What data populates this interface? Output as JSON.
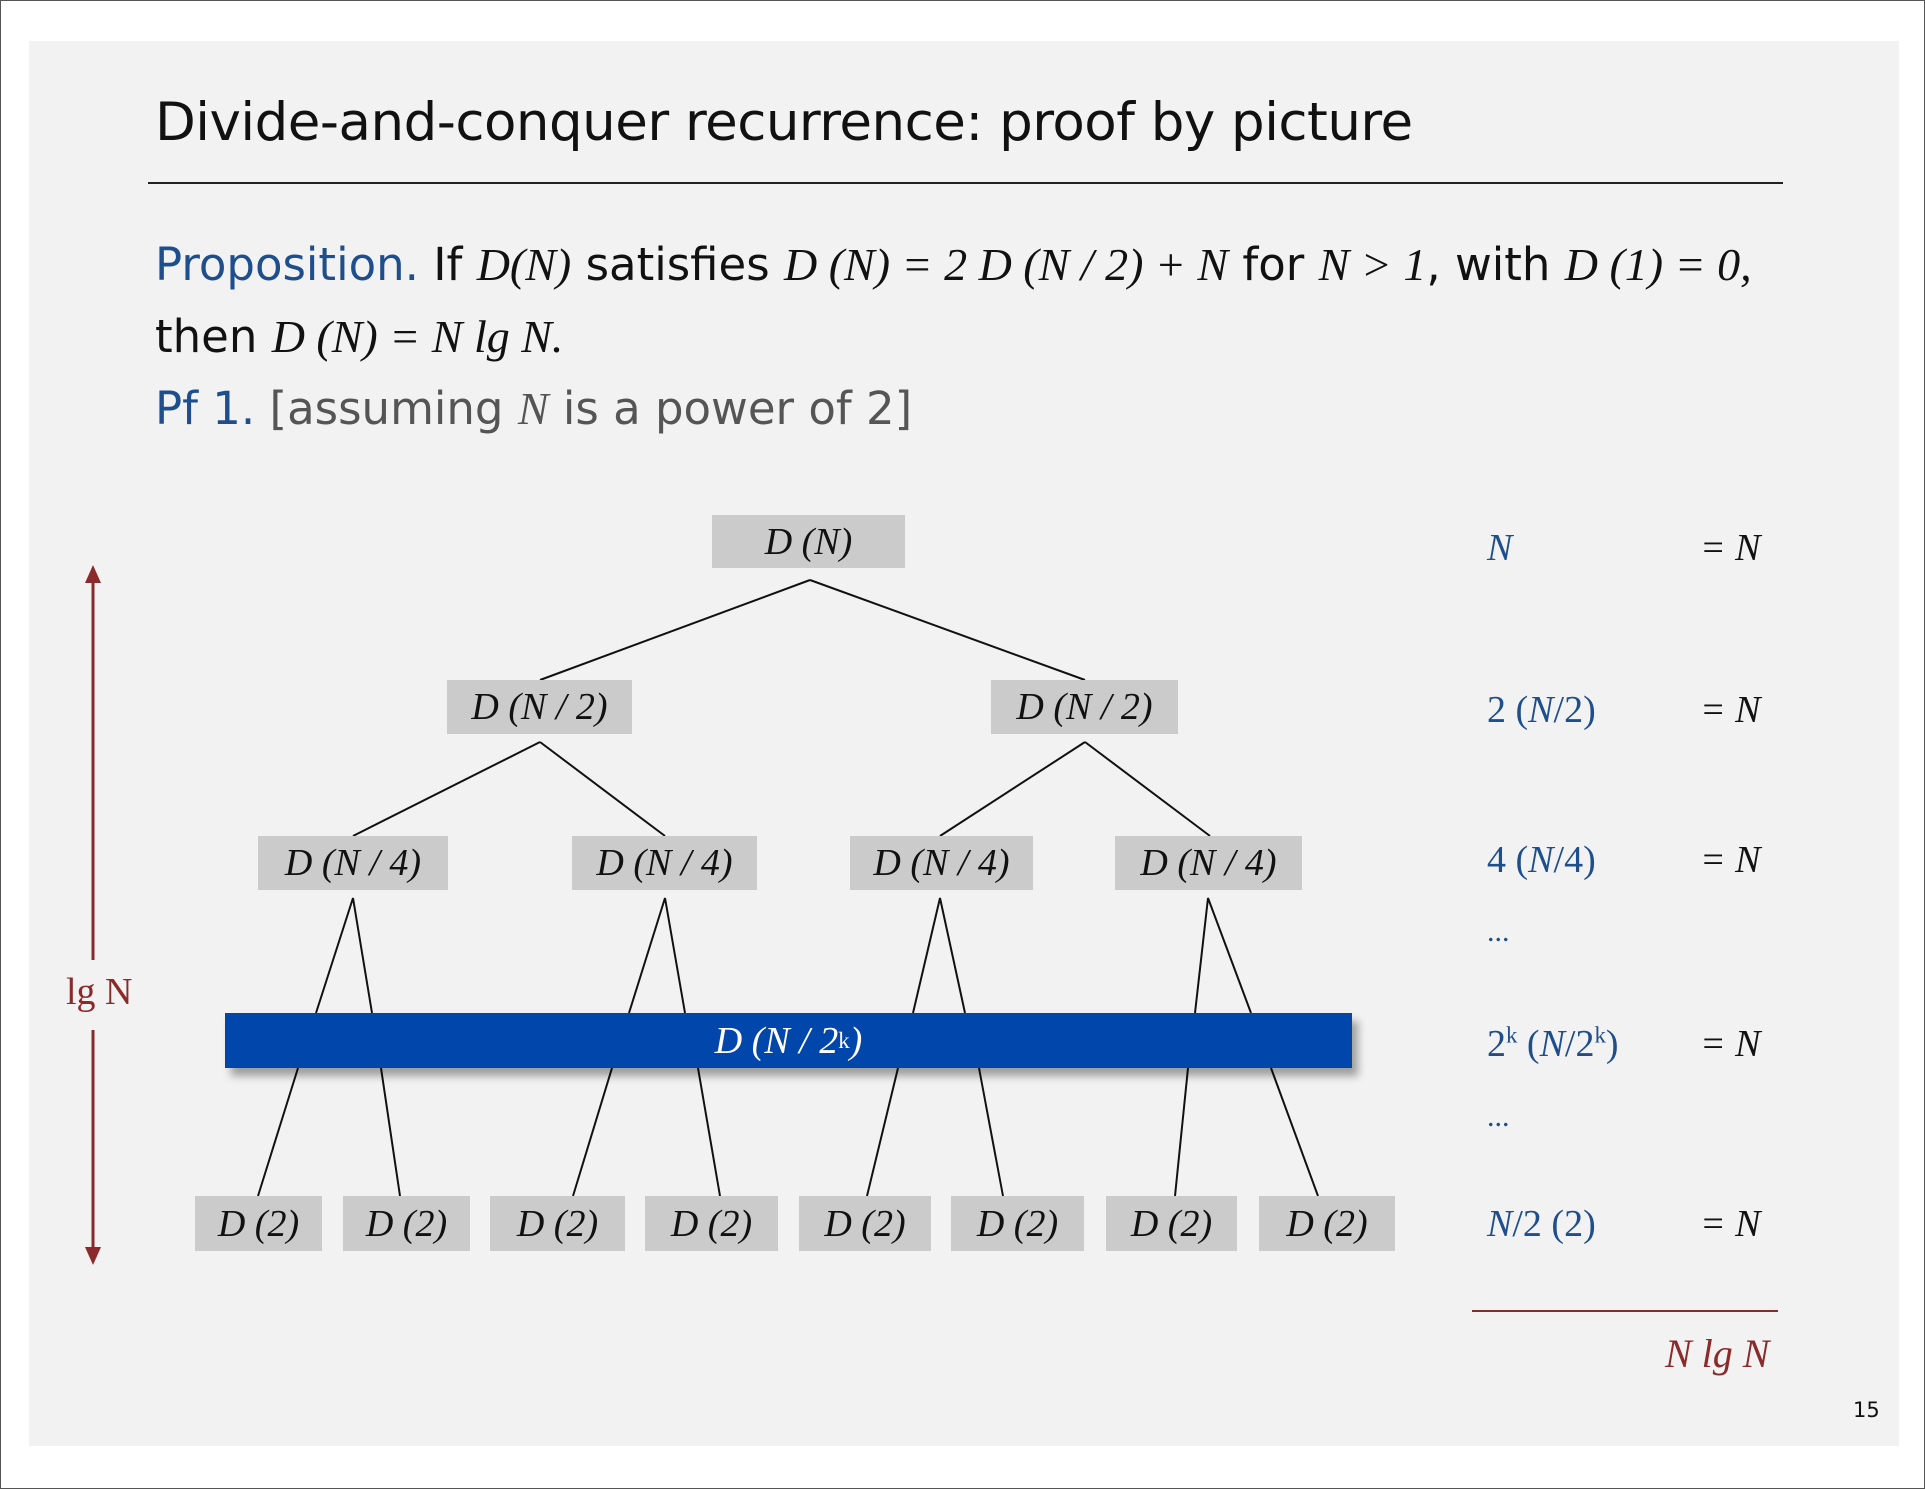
{
  "slide": {
    "title": "Divide-and-conquer recurrence:  proof by picture",
    "proposition_label": "Proposition.",
    "prop_if": "If",
    "prop_DN_a": "D",
    "prop_DN_b": "(N)",
    "prop_satisfies": "satisfies",
    "prop_eq_lhs": "D (N) = ",
    "prop_eq_rhs": "2 D (N / 2) + N",
    "prop_for": "for",
    "prop_cond": "N > 1",
    "prop_with": ", with",
    "prop_init": "D (1) = 0,",
    "then_label": "then",
    "then_expr": "D (N) = N lg N.",
    "pf_label": "Pf 1.",
    "pf_text_a": "[assuming",
    "pf_N": "N",
    "pf_text_b": "is a power of 2]",
    "page_number": "15"
  },
  "tree": {
    "root": "D (N)",
    "level1": [
      "D (N / 2)",
      "D (N / 2)"
    ],
    "level2": [
      "D (N / 4)",
      "D (N / 4)",
      "D (N / 4)",
      "D (N / 4)"
    ],
    "band": "D (N / 2",
    "band_sup": "k",
    "band_close": ")",
    "leaves": [
      "D (2)",
      "D (2)",
      "D (2)",
      "D (2)",
      "D (2)",
      "D (2)",
      "D (2)",
      "D (2)"
    ],
    "height_label": "lg N"
  },
  "sums": {
    "rows": [
      {
        "term": "N",
        "eq": "= N"
      },
      {
        "term": "2 (N/2)",
        "eq": "= N"
      },
      {
        "term": "4 (N/4)",
        "eq": "= N"
      },
      {
        "term": "2k (N/2k)",
        "eq": "= N"
      },
      {
        "term": "N/2 (2)",
        "eq": "= N"
      }
    ],
    "ellipsis": "...",
    "total": "N lg N"
  },
  "colors": {
    "accent_blue": "#1f4e8c",
    "band_blue": "#0146ab",
    "dark_red": "#8b2a2a",
    "box_gray": "#cbcbcb"
  }
}
